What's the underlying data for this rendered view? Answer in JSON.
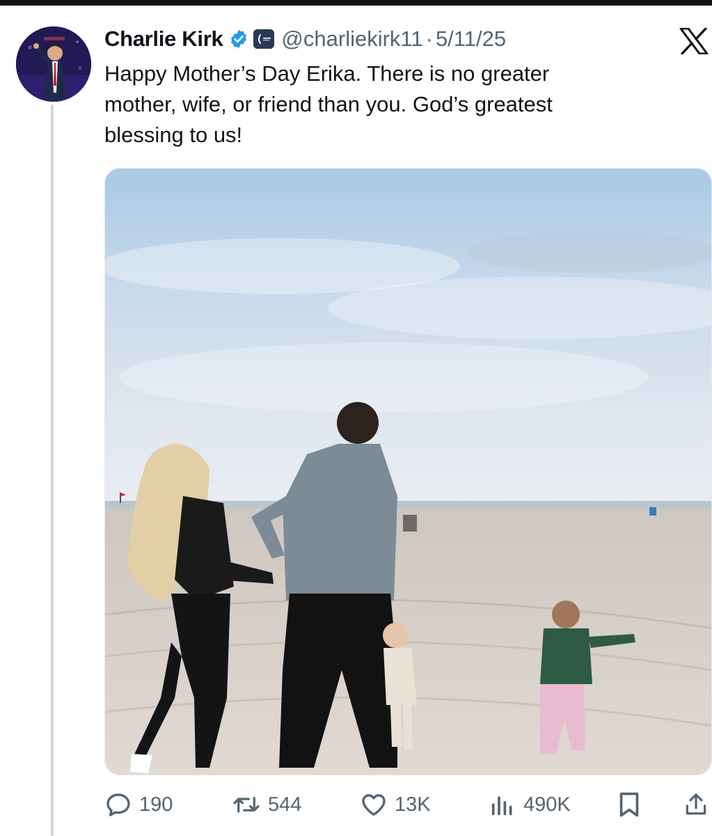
{
  "tweet": {
    "author_name": "Charlie Kirk",
    "handle": "@charliekirk11",
    "separator": "·",
    "date": "5/11/25",
    "text": "Happy Mother’s Day Erika. There is no greater\nmother, wife, or friend than you. God’s greatest\nblessing to us!",
    "media_alt": "Family walking on the beach under a cloudy sky"
  },
  "stats": {
    "replies": "190",
    "reposts": "544",
    "likes": "13K",
    "views": "490K"
  },
  "icons": {
    "verified": "verified-badge-icon",
    "org": "organization-badge-icon",
    "platform": "x-logo-icon",
    "reply": "reply-icon",
    "repost": "repost-icon",
    "like": "heart-icon",
    "views": "views-icon",
    "bookmark": "bookmark-icon",
    "share": "share-icon"
  },
  "colors": {
    "text_primary": "#0f1419",
    "text_secondary": "#536471",
    "verified_blue": "#1d9bf0",
    "thread_line": "#cfd9de"
  }
}
